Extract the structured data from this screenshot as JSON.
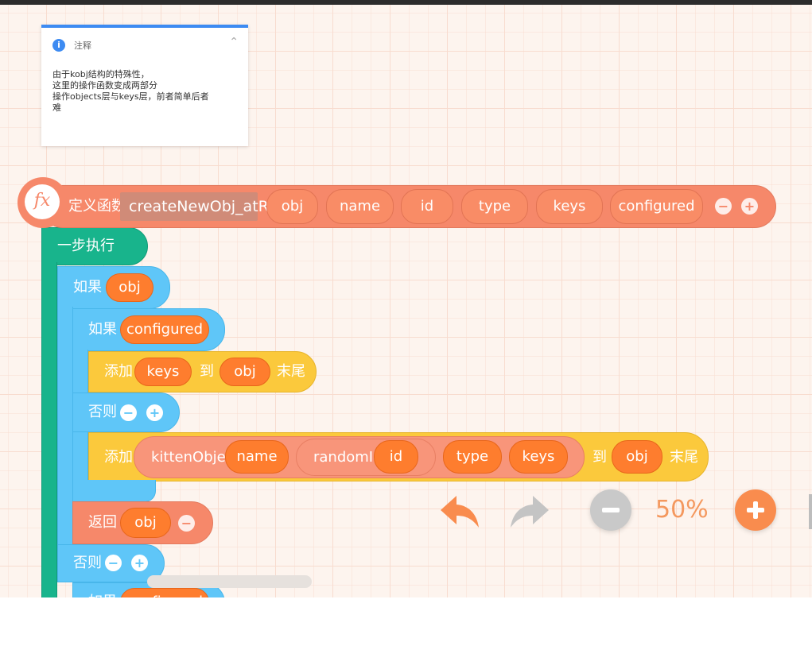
{
  "comment": {
    "title": "注释",
    "lines": [
      "由于kobj结构的特殊性，",
      "这里的操作函数变成两部分",
      "操作objects层与keys层，前者简单后者",
      "难"
    ]
  },
  "define": {
    "fx_label": "fx",
    "label": "定义函数",
    "function_name": "createNewObj_atROOT",
    "params": [
      "obj",
      "name",
      "id",
      "type",
      "keys",
      "configured"
    ]
  },
  "step": {
    "label": "一步执行"
  },
  "if1": {
    "label": "如果",
    "var": "obj"
  },
  "if2": {
    "label": "如果",
    "var": "configured"
  },
  "append1": {
    "label": "添加",
    "item": "keys",
    "to": "到",
    "target": "obj",
    "end": "末尾"
  },
  "else1": {
    "label": "否则"
  },
  "append2": {
    "label": "添加",
    "call": "kittenObject",
    "arg_name": "name",
    "random": "randomId",
    "arg_id": "id",
    "arg_type": "type",
    "arg_keys": "keys",
    "to": "到",
    "target": "obj",
    "end": "末尾"
  },
  "return": {
    "label": "返回",
    "var": "obj"
  },
  "else2": {
    "label": "否则"
  },
  "partial_if": {
    "label": "如果",
    "var": "configured"
  },
  "controls": {
    "zoom_level": "50%",
    "undo": "undo-icon",
    "redo": "redo-icon",
    "zoom_out": "zoom-out-icon",
    "zoom_in": "zoom-in-icon"
  },
  "colors": {
    "define_block": "#f6886a",
    "step_block": "#18b48c",
    "if_block": "#5fc6f8",
    "append_block": "#fbc93c",
    "variable": "#fe7d2e",
    "comment_accent": "#3d8bf2"
  }
}
